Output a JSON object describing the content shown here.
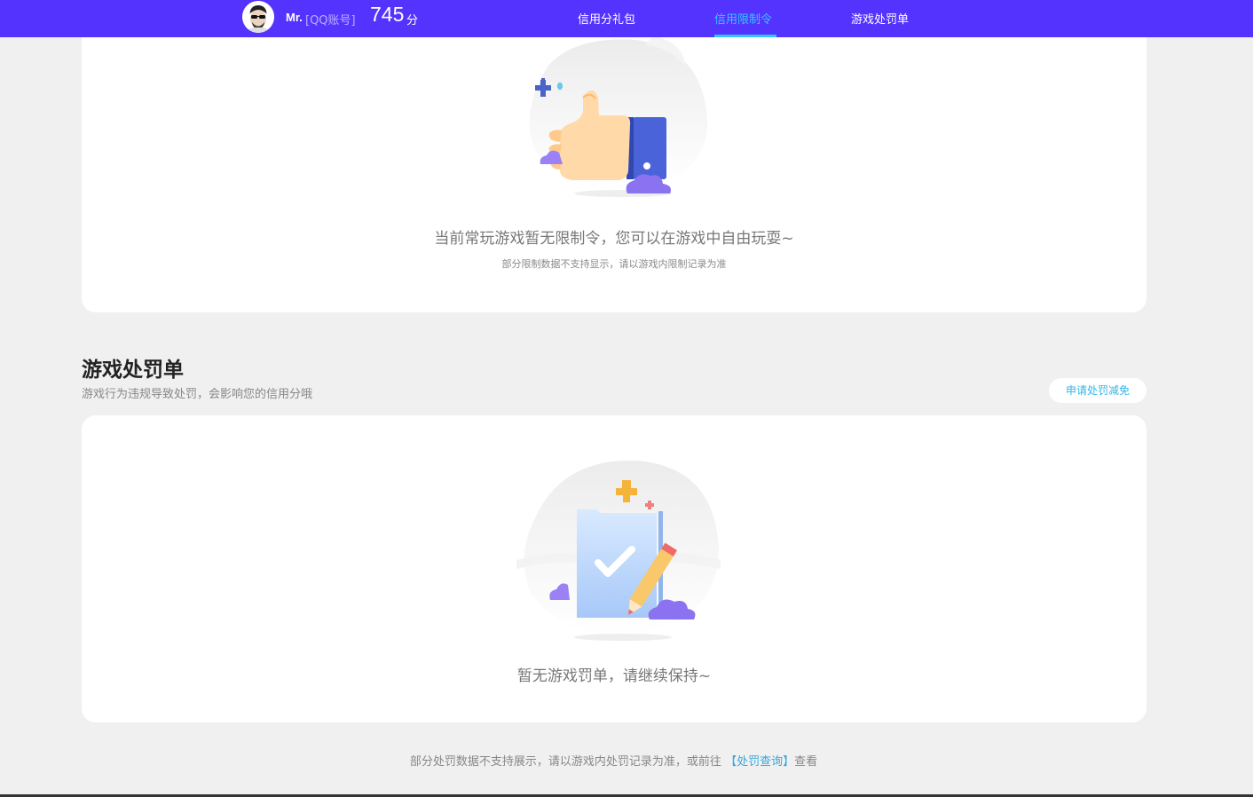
{
  "header": {
    "user_name": "Mr.",
    "user_account": "[QQ账号]",
    "score": "745",
    "score_unit": "分",
    "tabs": [
      {
        "label": "信用分礼包"
      },
      {
        "label": "信用限制令"
      },
      {
        "label": "游戏处罚单"
      }
    ],
    "active_tab": "信用限制令",
    "colors": {
      "bar": "#5533ff",
      "active": "#34c6ff"
    }
  },
  "restriction": {
    "empty_title": "当前常玩游戏暂无限制令，您可以在游戏中自由玩耍~",
    "empty_note": "部分限制数据不支持显示，请以游戏内限制记录为准",
    "illustration_icon": "thumbs-up-icon"
  },
  "penalty": {
    "title": "游戏处罚单",
    "desc": "游戏行为违规导致处罚，会影响您的信用分哦",
    "appeal_button": "申请处罚减免",
    "empty_title": "暂无游戏罚单，请继续保持~",
    "illustration_icon": "checklist-pencil-icon"
  },
  "footer": {
    "note_prefix": "部分处罚数据不支持展示，请以游戏内处罚记录为准，或前往",
    "link": "【处罚查询】",
    "note_suffix": "查看"
  }
}
